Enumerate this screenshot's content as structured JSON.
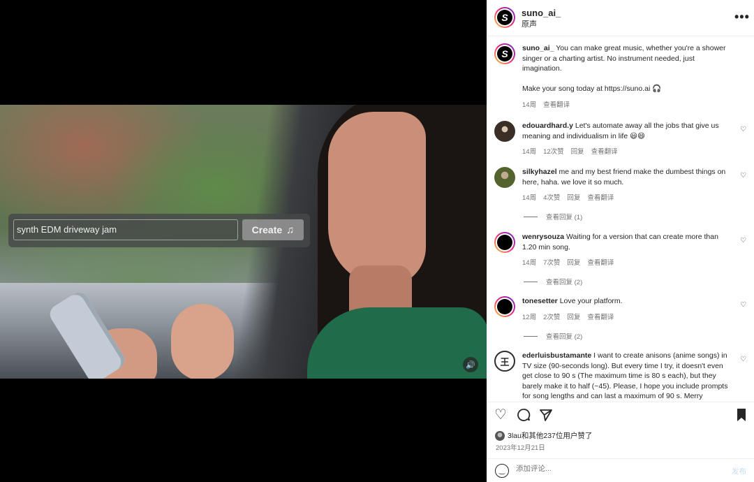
{
  "video": {
    "prompt_text": "synth EDM driveway jam",
    "create_label": "Create",
    "note_icon": "music-note-icon",
    "mute_icon": "speaker-icon"
  },
  "header": {
    "username": "suno_ai_",
    "subtitle": "原声",
    "more_icon": "•••"
  },
  "caption": {
    "username": "suno_ai_",
    "text": "You can make great music, whether you're a shower singer or a charting artist. No instrument needed, just imagination.",
    "text2": "Make your song today at https://suno.ai 🎧",
    "time": "14周",
    "translate": "查看翻译"
  },
  "comments": [
    {
      "username": "edouardhard.y",
      "text": "Let's automate away all the jobs that give us meaning and individualism in life 😃😄",
      "time": "14周",
      "likes": "12次赞",
      "reply": "回复",
      "translate": "查看翻译",
      "view_replies": ""
    },
    {
      "username": "silkyhazel",
      "text": "me and my best friend make the dumbest things on here, haha. we love it so much.",
      "time": "14周",
      "likes": "4次赞",
      "reply": "回复",
      "translate": "查看翻译",
      "view_replies": "查看回复 (1)"
    },
    {
      "username": "wenrysouza",
      "text": "Waiting for a version that can create more than 1.20 min song.",
      "time": "14周",
      "likes": "7次赞",
      "reply": "回复",
      "translate": "查看翻译",
      "view_replies": "查看回复 (2)"
    },
    {
      "username": "tonesetter",
      "text": "Love your platform.",
      "time": "12周",
      "likes": "2次赞",
      "reply": "回复",
      "translate": "查看翻译",
      "view_replies": "查看回复 (2)"
    },
    {
      "username": "ederluisbustamante",
      "text": "I want to create anisons (anime songs) in TV size (90-seconds long). But every time I try, it doesn't even get close to 90 s (The maximum time is 80 s each), but they barely make it to half (~45). Please, I hope you include prompts for song lengths and can last a maximum of 90 s. Merry",
      "time": "",
      "likes": "",
      "reply": "",
      "translate": "",
      "view_replies": ""
    }
  ],
  "actions": {
    "likes_text": "3lau和其他237位用户赞了",
    "date": "2023年12月21日"
  },
  "comment_box": {
    "placeholder": "添加评论...",
    "post_label": "发布"
  }
}
